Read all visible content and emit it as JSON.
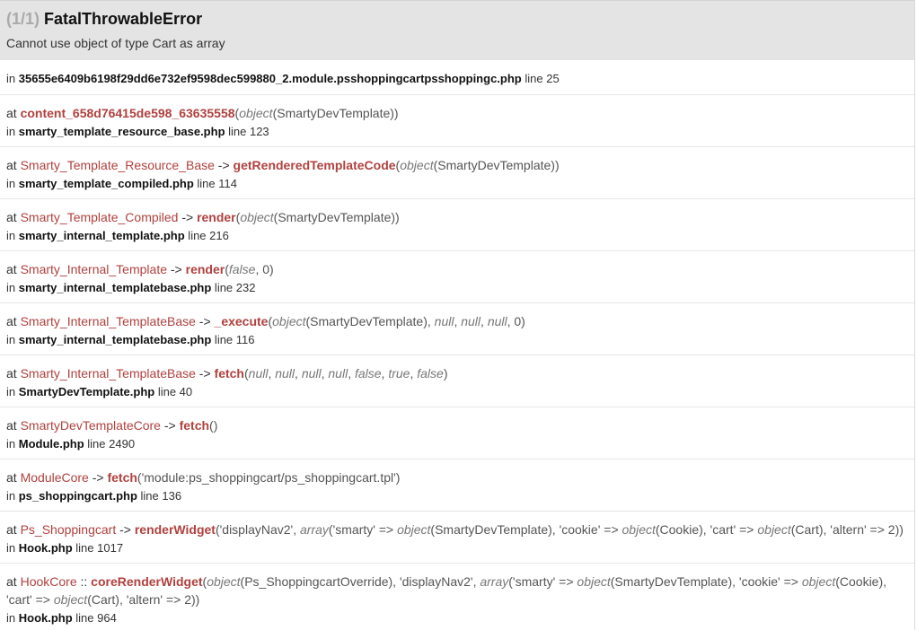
{
  "header": {
    "count": "(1/1)",
    "exception": "FatalThrowableError",
    "message": "Cannot use object of type Cart as array"
  },
  "origin": {
    "in_label": "in",
    "file": "35655e6409b6198f29dd6e732ef9598dec599880_2.module.psshoppingcartpsshoppingc.php",
    "line": "line 25"
  },
  "trace": [
    {
      "at": "at",
      "cls": "",
      "sep": "",
      "fn": "content_658d76415de598_63635558",
      "args_html": "(<i>object</i>(SmartyDevTemplate))",
      "file": "smarty_template_resource_base.php",
      "line": "line 123"
    },
    {
      "at": "at",
      "cls": "Smarty_Template_Resource_Base",
      "sep": "->",
      "fn": "getRenderedTemplateCode",
      "args_html": "(<i>object</i>(SmartyDevTemplate))",
      "file": "smarty_template_compiled.php",
      "line": "line 114"
    },
    {
      "at": "at",
      "cls": "Smarty_Template_Compiled",
      "sep": "->",
      "fn": "render",
      "args_html": "(<i>object</i>(SmartyDevTemplate))",
      "file": "smarty_internal_template.php",
      "line": "line 216"
    },
    {
      "at": "at",
      "cls": "Smarty_Internal_Template",
      "sep": "->",
      "fn": "render",
      "args_html": "(<i>false</i>, 0)",
      "file": "smarty_internal_templatebase.php",
      "line": "line 232"
    },
    {
      "at": "at",
      "cls": "Smarty_Internal_TemplateBase",
      "sep": "->",
      "fn": "_execute",
      "args_html": "(<i>object</i>(SmartyDevTemplate), <i>null</i>, <i>null</i>, <i>null</i>, 0)",
      "file": "smarty_internal_templatebase.php",
      "line": "line 116"
    },
    {
      "at": "at",
      "cls": "Smarty_Internal_TemplateBase",
      "sep": "->",
      "fn": "fetch",
      "args_html": "(<i>null</i>, <i>null</i>, <i>null</i>, <i>null</i>, <i>false</i>, <i>true</i>, <i>false</i>)",
      "file": "SmartyDevTemplate.php",
      "line": "line 40"
    },
    {
      "at": "at",
      "cls": "SmartyDevTemplateCore",
      "sep": "->",
      "fn": "fetch",
      "args_html": "()",
      "file": "Module.php",
      "line": "line 2490"
    },
    {
      "at": "at",
      "cls": "ModuleCore",
      "sep": "->",
      "fn": "fetch",
      "args_html": "('module:ps_shoppingcart/ps_shoppingcart.tpl')",
      "file": "ps_shoppingcart.php",
      "line": "line 136"
    },
    {
      "at": "at",
      "cls": "Ps_Shoppingcart",
      "sep": "->",
      "fn": "renderWidget",
      "args_html": "('displayNav2', <i>array</i>('smarty' => <i>object</i>(SmartyDevTemplate), 'cookie' => <i>object</i>(Cookie), 'cart' => <i>object</i>(Cart), 'altern' => 2))",
      "file": "Hook.php",
      "line": "line 1017"
    },
    {
      "at": "at",
      "cls": "HookCore",
      "sep": "::",
      "fn": "coreRenderWidget",
      "args_html": "(<i>object</i>(Ps_ShoppingcartOverride), 'displayNav2', <i>array</i>('smarty' => <i>object</i>(SmartyDevTemplate), 'cookie' => <i>object</i>(Cookie), 'cart' => <i>object</i>(Cart), 'altern' => 2))",
      "file": "Hook.php",
      "line": "line 964"
    }
  ]
}
